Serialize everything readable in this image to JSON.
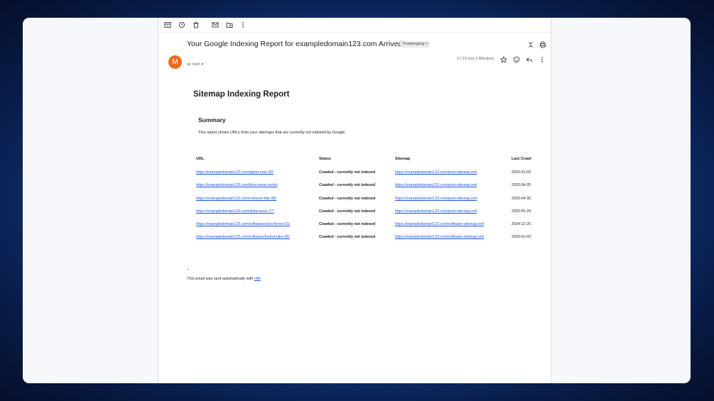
{
  "email": {
    "subject": "Your Google Indexing Report for exampledomain123.com Arrived.",
    "label": "Posteingang ×",
    "avatar_letter": "M",
    "to_line": "an mich ▾",
    "time": "17:23 (vor 2 Minuten)"
  },
  "report": {
    "title": "Sitemap Indexing Report",
    "summary_title": "Summary",
    "summary_text": "This report shows URLs from your sitemaps that are currently not indexed by Google.",
    "headers": {
      "url": "URL",
      "status": "Status",
      "sitemap": "Sitemap",
      "last_crawl": "Last Crawl"
    },
    "rows": [
      {
        "url": "https://exampledomain123.com/alpha-rose-42/",
        "status": "Crawled - currently not indexed",
        "sitemap": "https://exampledomain123.com/post-sitemap.xml",
        "last_crawl": "2025-01-03"
      },
      {
        "url": "https://exampledomain123.com/blue-moon-echo/",
        "status": "Crawled - currently not indexed",
        "sitemap": "https://exampledomain123.com/post-sitemap.xml",
        "last_crawl": "2025-04-25"
      },
      {
        "url": "https://exampledomain123.com/crimson-tide-99/",
        "status": "Crawled - currently not indexed",
        "sitemap": "https://exampledomain123.com/post-sitemap.xml",
        "last_crawl": "2025-04-30"
      },
      {
        "url": "https://exampledomain123.com/delta-wave-77/",
        "status": "Crawled - currently not indexed",
        "sitemap": "https://exampledomain123.com/post-sitemap.xml",
        "last_crawl": "2025-05-24"
      },
      {
        "url": "https://exampledomain123.com/software/echo-forest-21/",
        "status": "Crawled - currently not indexed",
        "sitemap": "https://exampledomain123.com/software-sitemap.xml",
        "last_crawl": "2024-12-25"
      },
      {
        "url": "https://exampledomain123.com/software/foxtrot-lake-56/",
        "status": "Crawled - currently not indexed",
        "sitemap": "https://exampledomain123.com/software-sitemap.xml",
        "last_crawl": "2025-01-03"
      }
    ]
  },
  "signature": {
    "dash": "--",
    "text": "This email was sent automatically with ",
    "link": "n8n"
  },
  "icons": {
    "toolbar": [
      "archive-icon",
      "snooze-icon",
      "delete-icon",
      "mark-unread-icon",
      "move-to-icon",
      "more-vert-icon"
    ],
    "header": [
      "collapse-icon",
      "print-icon",
      "star-icon",
      "emoji-icon",
      "reply-icon",
      "more-vert-icon"
    ]
  },
  "colors": {
    "avatar": "#ea6c1f",
    "link": "#1a56d8",
    "background": "#123a86"
  }
}
